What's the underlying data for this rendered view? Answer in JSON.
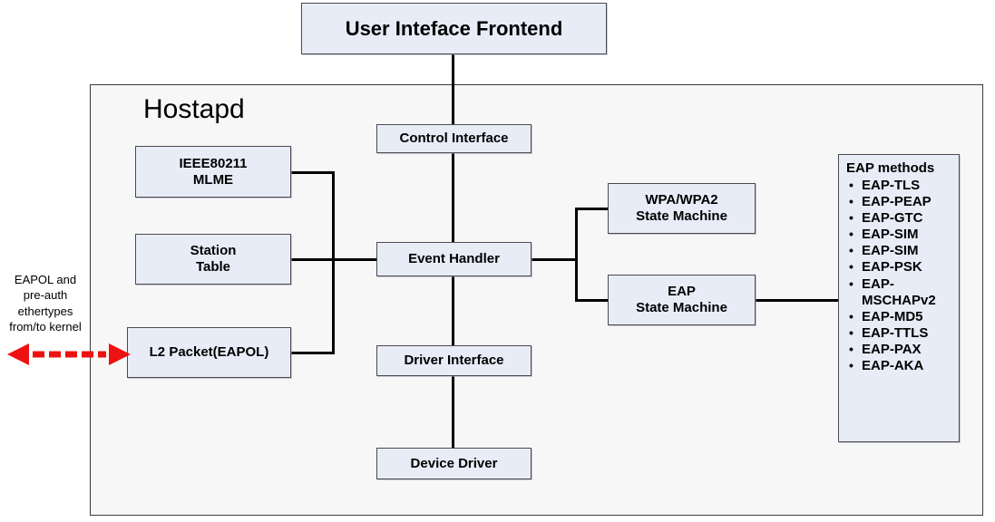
{
  "diagram": {
    "title_box": {
      "label": "User Inteface Frontend"
    },
    "container": {
      "label": "Hostapd"
    },
    "external_note": {
      "line1": "EAPOL and",
      "line2": "pre-auth",
      "line3": "ethertypes",
      "line4": "from/to kernel"
    },
    "arrow": {
      "name": "red-dashed-double-arrow",
      "color": "#ee1111",
      "style": "dashed",
      "heads": "both"
    },
    "nodes": [
      {
        "id": "ieee80211-mlme",
        "label_line1": "IEEE80211",
        "label_line2": "MLME"
      },
      {
        "id": "station-table",
        "label_line1": "Station",
        "label_line2": "Table"
      },
      {
        "id": "l2-packet-eapol",
        "label_line1": "L2 Packet(EAPOL)",
        "label_line2": ""
      },
      {
        "id": "control-interface",
        "label_line1": "Control Interface",
        "label_line2": ""
      },
      {
        "id": "event-handler",
        "label_line1": "Event Handler",
        "label_line2": ""
      },
      {
        "id": "driver-interface",
        "label_line1": "Driver Interface",
        "label_line2": ""
      },
      {
        "id": "device-driver",
        "label_line1": "Device Driver",
        "label_line2": ""
      },
      {
        "id": "wpa-wpa2-state-machine",
        "label_line1": "WPA/WPA2",
        "label_line2": "State Machine"
      },
      {
        "id": "eap-state-machine",
        "label_line1": "EAP",
        "label_line2": "State Machine"
      }
    ],
    "eap_methods": {
      "header": "EAP methods",
      "items": [
        "EAP-TLS",
        "EAP-PEAP",
        "EAP-GTC",
        "EAP-SIM",
        "EAP-SIM",
        "EAP-PSK",
        "EAP-MSCHAPv2",
        "EAP-MD5",
        "EAP-TTLS",
        "EAP-PAX",
        "EAP-AKA"
      ]
    },
    "colors": {
      "box_fill": "#e8ecf7",
      "box_border": "#4a4a52",
      "container_fill": "#f7f7f7",
      "container_border": "#3a3a3a",
      "connector": "#000000",
      "arrow_red": "#ee1111"
    }
  }
}
